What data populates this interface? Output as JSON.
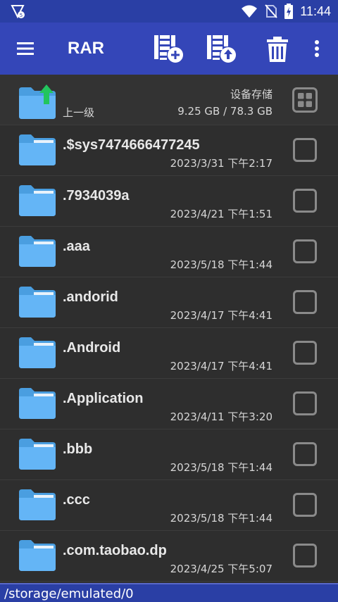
{
  "status_bar": {
    "time": "11:44"
  },
  "app_bar": {
    "title": "RAR"
  },
  "parent_row": {
    "label": "上一级",
    "storage_label": "设备存储",
    "storage_size": "9.25 GB / 78.3 GB"
  },
  "files": [
    {
      "name": ".$sys7474666477245",
      "date": "2023/3/31 下午2:17"
    },
    {
      "name": ".7934039a",
      "date": "2023/4/21 下午1:51"
    },
    {
      "name": ".aaa",
      "date": "2023/5/18 下午1:44"
    },
    {
      "name": ".andorid",
      "date": "2023/4/17 下午4:41"
    },
    {
      "name": ".Android",
      "date": "2023/4/17 下午4:41"
    },
    {
      "name": ".Application",
      "date": "2023/4/11 下午3:20"
    },
    {
      "name": ".bbb",
      "date": "2023/5/18 下午1:44"
    },
    {
      "name": ".ccc",
      "date": "2023/5/18 下午1:44"
    },
    {
      "name": ".com.taobao.dp",
      "date": "2023/4/25 下午5:07"
    }
  ],
  "path_bar": {
    "path": "/storage/emulated/0"
  },
  "colors": {
    "app_bar": "#3446b8",
    "status_bar": "#2a3fa5",
    "folder": "#64b5f6",
    "up_arrow": "#22c55e",
    "background": "#2e2e2e"
  }
}
